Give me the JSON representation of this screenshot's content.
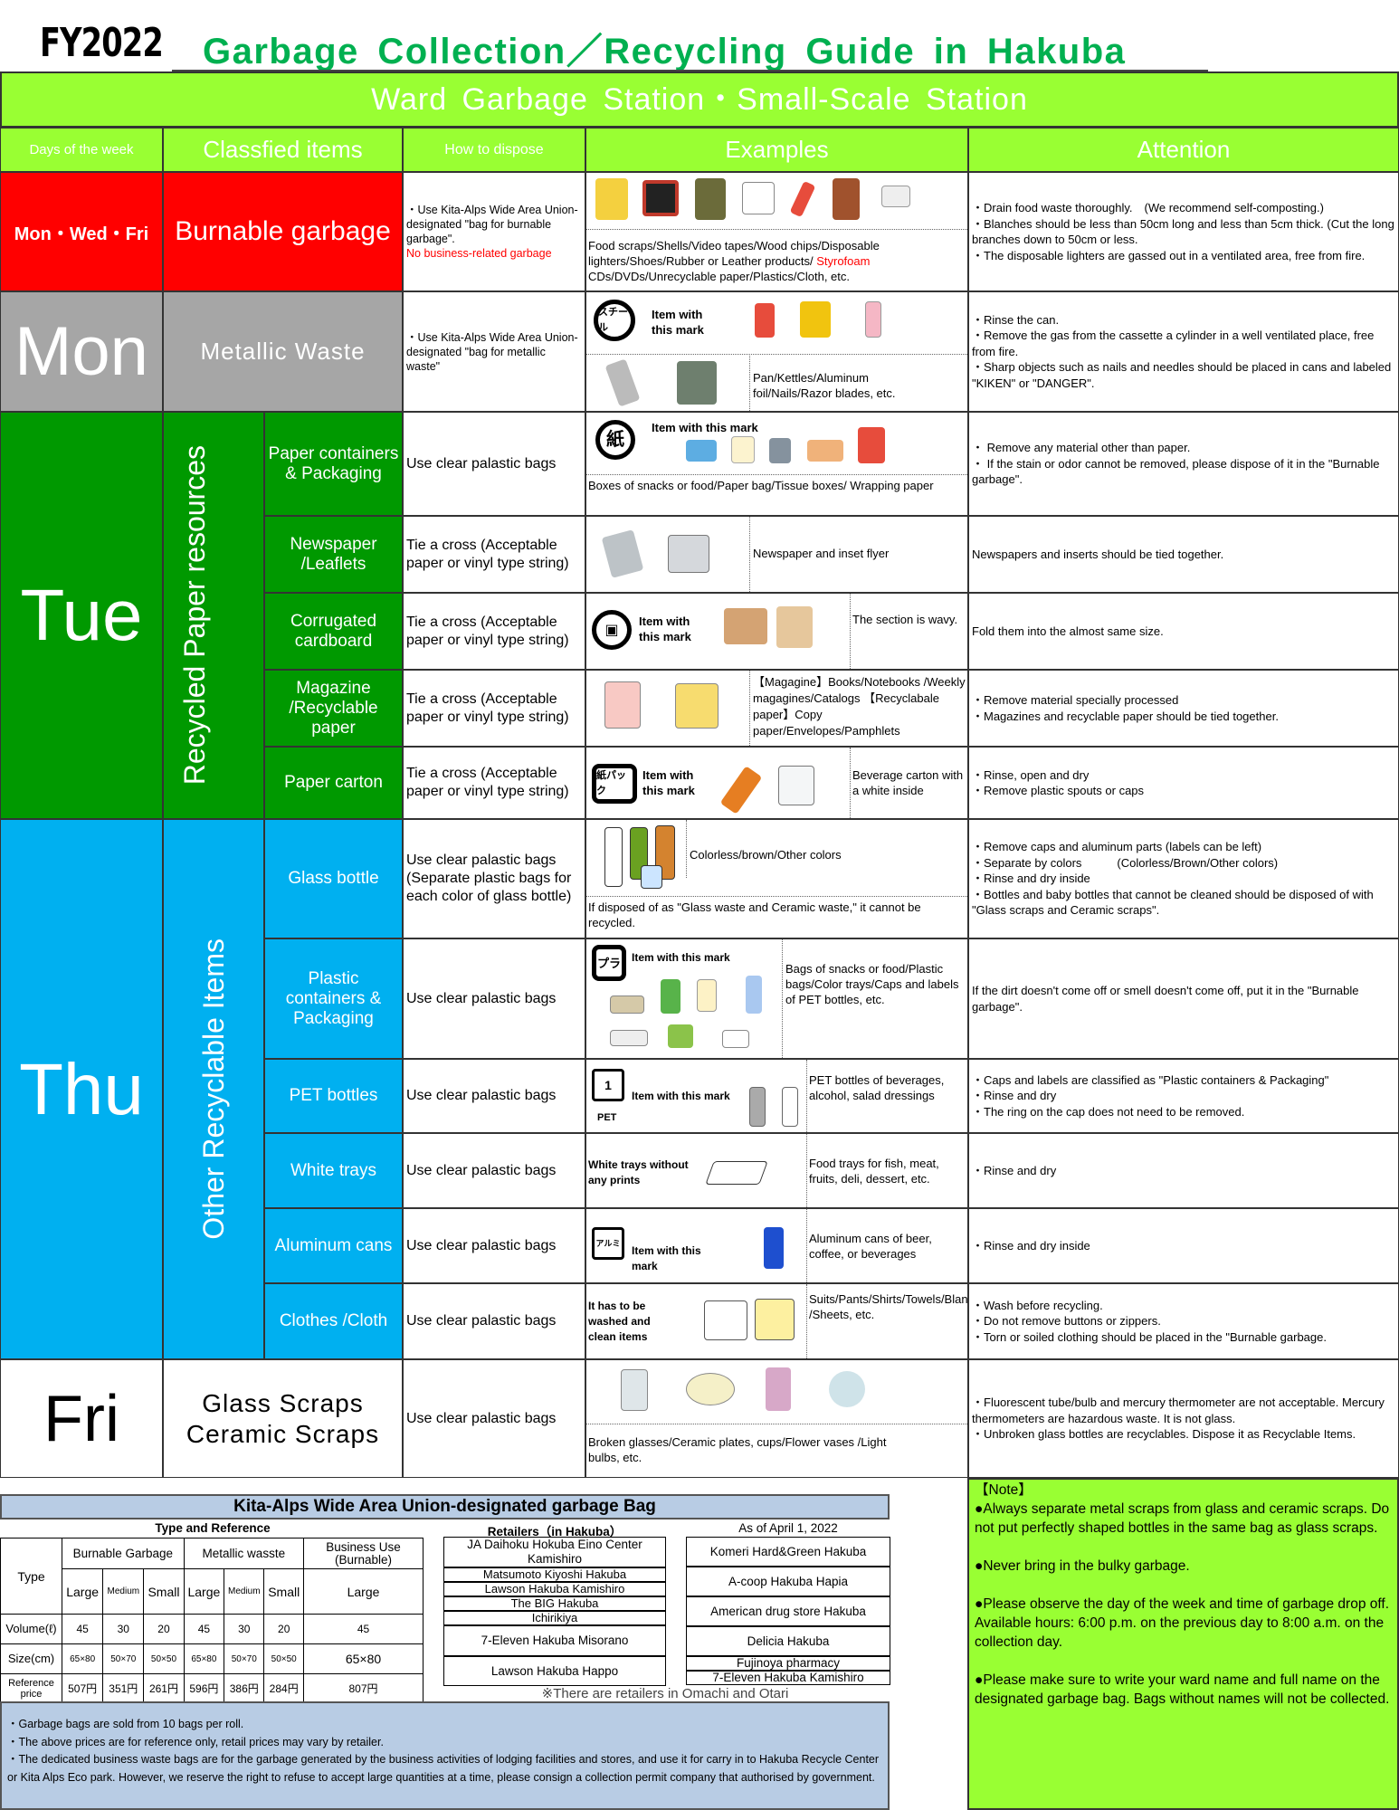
{
  "header": {
    "fy": "FY2022",
    "title": "Garbage Collection／Recycling Guide in Hakuba",
    "banner": "Ward Garbage Station・Small-Scale Station"
  },
  "columns": {
    "days": "Days of the week",
    "items": "Classfied items",
    "how": "How to dispose",
    "examples": "Examples",
    "attention": "Attention"
  },
  "colors": {
    "burnable": "#ff0000",
    "metallic": "#a6a6a6",
    "paper": "#009900",
    "recyclable": "#00b0f0",
    "header_green": "#99ff33",
    "title_green": "#00b050",
    "bag_blue": "#b8cce4"
  },
  "burnable": {
    "day": "Mon・Wed・Fri",
    "item": "Burnable garbage",
    "how": "・Use Kita-Alps Wide Area Union-designated \"bag for burnable garbage\".",
    "how_warning": "No business-related garbage",
    "examples": "Food scraps/Shells/Video tapes/Wood chips/Disposable lighters/Shoes/Rubber or Leather products/",
    "examples_red": "Styrofoam",
    "examples_tail": "CDs/DVDs/Unrecyclable paper/Plastics/Cloth, etc.",
    "attention": [
      "・Drain food waste thoroughly.　(We recommend self-composting.)",
      "・Blanches should be less than 50cm long and less than 5cm thick. (Cut the long branches down to 50cm or less.",
      "・The disposable lighters are gassed out in a  ventilated area, free from fire."
    ]
  },
  "metallic": {
    "day": "Mon",
    "item": "Metallic Waste",
    "how": "・Use Kita-Alps Wide Area Union-designated \"bag for metallic waste\"",
    "mark_label": "スチール",
    "mark_text": "Item with this mark",
    "examples": "Pan/Kettles/Aluminum foil/Nails/Razor blades, etc.",
    "attention": [
      "・Rinse the can.",
      "・Remove the gas from the cassette a cylinder in a well ventilated place, free from fire.",
      "・Sharp objects such as nails and needles should be placed in cans and labeled \"KIKEN\" or \"DANGER\"."
    ]
  },
  "paper": {
    "day": "Tue",
    "group": "Recycled Paper resources",
    "rows": [
      {
        "item": "Paper containers & Packaging",
        "how": "Use clear palastic bags",
        "mark_label": "紙",
        "mark_text": "Item with this mark",
        "examples": "Boxes of snacks or food/Paper bag/Tissue boxes/ Wrapping paper",
        "attention": [
          "・ Remove any material other than paper.",
          "・ If the stain or odor cannot be removed, please dispose of it in the \"Burnable garbage\"."
        ]
      },
      {
        "item": "Newspaper /Leaflets",
        "how": "Tie a cross (Acceptable paper or vinyl type string)",
        "examples": "Newspaper and inset flyer",
        "attention": [
          "Newspapers and inserts should be tied together."
        ]
      },
      {
        "item": "Corrugated cardboard",
        "how": "Tie a cross (Acceptable paper or vinyl type string)",
        "mark_text": "Item with this mark",
        "examples": "The section is wavy.",
        "attention": [
          "Fold them into the almost same size."
        ]
      },
      {
        "item": "Magazine /Recyclable paper",
        "how": "Tie a cross (Acceptable paper or vinyl type string)",
        "examples": "【Magagine】Books/Notebooks /Weekly  magagines/Catalogs 【Recyclabale paper】Copy paper/Envelopes/Pamphlets",
        "attention": [
          "・Remove material specially processed",
          "・Magazines and recyclable paper should be tied together."
        ]
      },
      {
        "item": "Paper carton",
        "how": "Tie a cross (Acceptable paper or vinyl type string)",
        "mark_label": "紙パック",
        "mark_text": "Item with this mark",
        "examples": "Beverage carton with a white inside",
        "attention": [
          "・Rinse, open and dry",
          "・Remove plastic spouts or caps"
        ]
      }
    ]
  },
  "other": {
    "day": "Thu",
    "group": "Other Recyclable Items",
    "rows": [
      {
        "item": "Glass bottle",
        "how": "Use clear palastic bags (Separate plastic bags for each color of glass bottle)",
        "examples": "Colorless/brown/Other colors",
        "examples_note": "If disposed of as \"Glass waste and Ceramic waste,\" it cannot be recycled.",
        "attention": [
          "・Remove caps and aluminum parts (labels can be left)",
          "・Separate by colors　　　(Colorless/Brown/Other colors)",
          "・Rinse and dry inside",
          "・Bottles and baby bottles that cannot be cleaned should be disposed of with \"Glass scraps and Ceramic scraps\"."
        ]
      },
      {
        "item": "Plastic containers & Packaging",
        "how": "Use clear palastic bags",
        "mark_label": "プラ",
        "mark_text": "Item with this mark",
        "examples": "Bags of snacks or food/Plastic bags/Color trays/Caps and labels of PET bottles, etc.",
        "attention": [
          "If the dirt doesn't come off or smell doesn't come off, put it in the \"Burnable garbage\"."
        ]
      },
      {
        "item": "PET bottles",
        "how": "Use clear palastic bags",
        "mark_label": "1",
        "mark_sub": "PET",
        "mark_text": "Item with this mark",
        "examples": "PET bottles of beverages, alcohol, salad dressings",
        "attention": [
          "・Caps and labels are classified as \"Plastic containers & Packaging\"",
          "・Rinse and dry",
          "・The ring on the cap does not need to be removed."
        ]
      },
      {
        "item": "White trays",
        "how": "Use clear palastic bags",
        "mark_text": "White trays without any prints",
        "examples": "Food trays for fish, meat, fruits, deli, dessert, etc.",
        "attention": [
          "・Rinse and dry"
        ]
      },
      {
        "item": "Aluminum cans",
        "how": "Use clear palastic bags",
        "mark_label": "アルミ",
        "mark_text": "Item with this mark",
        "examples": "Aluminum cans of beer, coffee, or beverages",
        "attention": [
          "・Rinse and dry inside"
        ]
      },
      {
        "item": "Clothes /Cloth",
        "how": "Use clear palastic bags",
        "mark_text": "It has to be washed and clean items",
        "examples": "Suits/Pants/Shirts/Towels/Blankets /Sheets, etc.",
        "attention": [
          "・Wash before recycling.",
          "・Do not remove buttons or zippers.",
          "・Torn or soiled clothing should be placed in the \"Burnable garbage."
        ]
      }
    ]
  },
  "glass": {
    "day": "Fri",
    "item_line1": "Glass Scraps",
    "item_line2": "Ceramic Scraps",
    "how": "Use clear palastic bags",
    "examples": "Broken glasses/Ceramic plates, cups/Flower vases /Light bulbs, etc.",
    "attention": [
      "・Fluorescent tube/bulb and mercury thermometer are not acceptable. Mercury thermometers are hazardous waste. It is not glass.",
      "・Unbroken glass bottles are recyclables. Dispose it as Recyclable Items."
    ]
  },
  "bag": {
    "title": "Kita-Alps Wide Area Union-designated garbage Bag",
    "table_title": "Type and Reference",
    "type_label": "Type",
    "groups": [
      "Burnable Garbage",
      "Metallic wasste",
      "Business Use (Burnable)"
    ],
    "sizes": [
      "Large",
      "Medium",
      "Small",
      "Large",
      "Medium",
      "Small",
      "Large"
    ],
    "rows": [
      {
        "label": "Volume(ℓ)",
        "values": [
          "45",
          "30",
          "20",
          "45",
          "30",
          "20",
          "45"
        ]
      },
      {
        "label": "Size(cm)",
        "values": [
          "65×80",
          "50×70",
          "50×50",
          "65×80",
          "50×70",
          "50×50",
          "65×80"
        ]
      },
      {
        "label": "Reference price",
        "values": [
          "507円",
          "351円",
          "261円",
          "596円",
          "386円",
          "284円",
          "807円"
        ]
      }
    ],
    "retailers_title": "Retailers（in Hakuba）",
    "as_of": "As of April 1, 2022",
    "retailers_left": [
      "JA Daihoku Hokuba Eino Center Kamishiro",
      "Matsumoto Kiyoshi Hakuba",
      "Lawson Hakuba Kamishiro",
      "The BIG Hakuba",
      "Ichirikiya",
      "7-Eleven Hakuba Misorano",
      "Lawson Hakuba Happo"
    ],
    "retailers_right": [
      "Komeri Hard&Green Hakuba",
      "A-coop Hakuba Hapia",
      "American drug store Hakuba",
      "Delicia Hakuba",
      "Fujinoya pharmacy",
      "7-Eleven Hakuba Kamishiro"
    ],
    "retailers_note": "※There are retailers in Omachi and Otari",
    "notes": [
      "・Garbage bags are sold from 10 bags per roll.",
      "・The above prices are for reference only, retail prices may vary by retailer.",
      "・The dedicated business waste bags are for the garbage generated by the business activities of lodging facilities and stores, and use it for carry in to Hakuba Recycle Center or Kita Alps Eco park.  However, we reserve the right to refuse to accept large quantities at a time, please consign a collection permit company that authorised by government."
    ]
  },
  "note": {
    "title": "【Note】",
    "items": [
      "●Always separate metal scraps from glass and ceramic scraps. Do not put perfectly shaped bottles in the same bag as glass scraps.",
      "●Never bring in the bulky garbage.",
      "●Please observe the day of the week and time of garbage drop off. Available hours: 6:00 p.m. on the previous day to 8:00 a.m. on the collection day.",
      "●Please make sure to write your ward name and full name on the designated garbage bag. Bags without names will not be collected."
    ]
  }
}
